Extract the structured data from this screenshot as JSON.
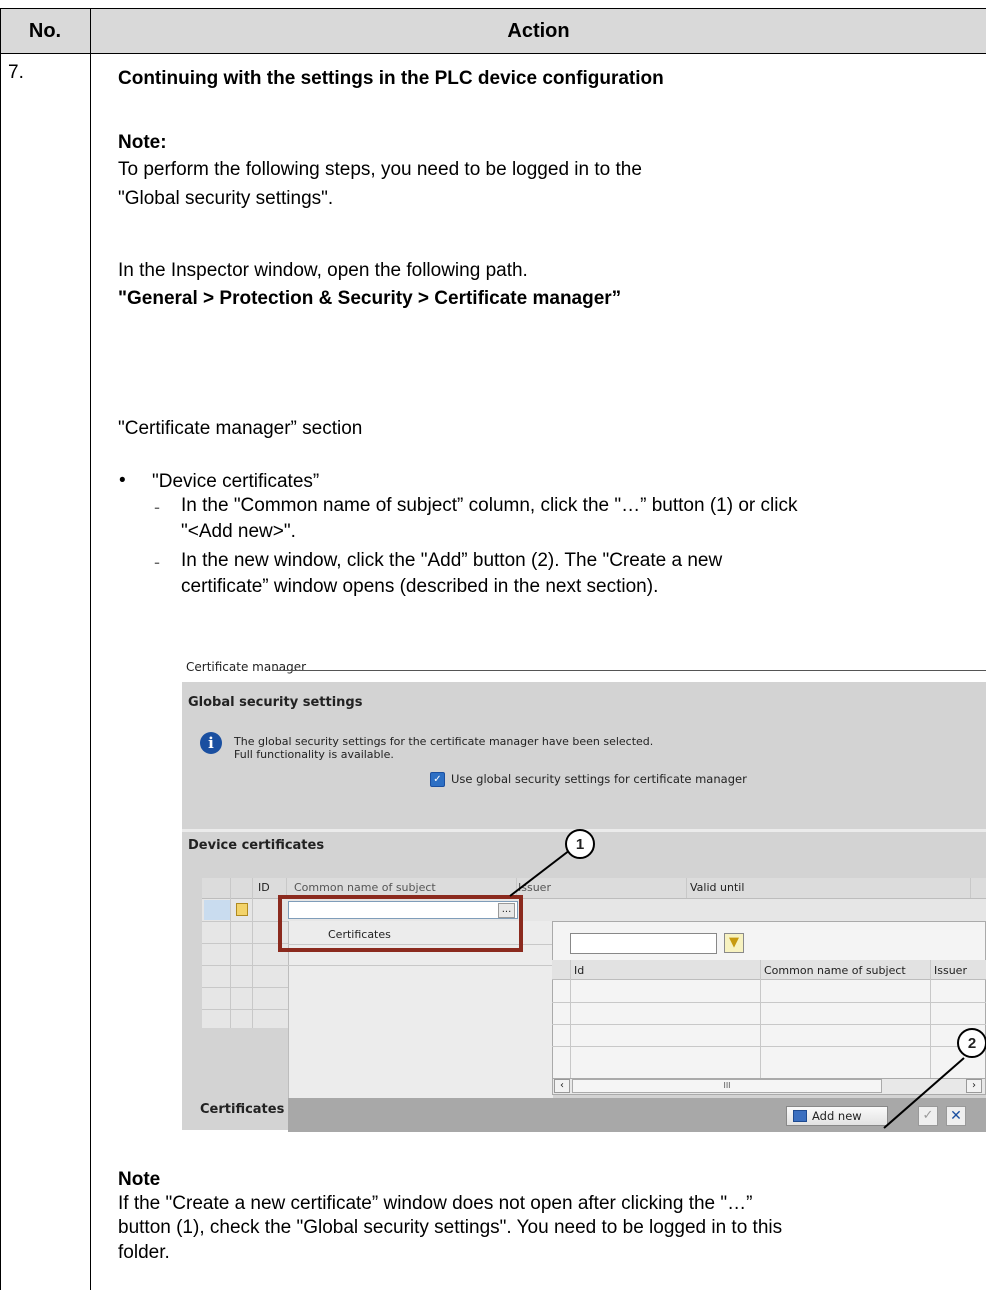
{
  "table": {
    "header_no": "No.",
    "header_action": "Action",
    "step_no": "7."
  },
  "step": {
    "title": "Continuing with the settings in the PLC device configuration",
    "note_label": "Note:",
    "note_line1": "To perform the following steps, you need to be logged in to the",
    "note_line2": "\"Global security settings\".",
    "inspector_text": "In the Inspector window, open the following path.",
    "path": "\"General > Protection & Security > Certificate manager”",
    "section_text": "\"Certificate manager” section",
    "bullet": "•",
    "bullet_label": "\"Device certificates”",
    "dash": "-",
    "sub1_line1": "In the \"Common name of subject” column, click the \"…” button (1) or click",
    "sub1_line2": "\"<Add new>\".",
    "sub2_line1": "In the new window, click the \"Add” button (2). The \"Create a new",
    "sub2_line2": "certificate” window opens (described in the next section).",
    "note2_label": "Note",
    "note2_line1": "If the \"Create a new certificate” window does not open after clicking the \"…”",
    "note2_line2": "button (1), check the \"Global security settings\". You need to be logged in to this",
    "note2_line3": "folder."
  },
  "screenshot": {
    "section_title": "Certificate manager",
    "global_title": "Global security settings",
    "info_line1": "The global security settings for the certificate manager have been selected.",
    "info_line2": "Full functionality is available.",
    "checkbox_label": "Use global security settings for certificate manager",
    "checkbox_checked": true,
    "device_certs_title": "Device certificates",
    "columns": [
      "ID",
      "Common name of subject",
      "Issuer",
      "Valid until"
    ],
    "browse_button": "...",
    "dropdown_item": "Certificates",
    "popup_columns": [
      "Id",
      "Common name of subject",
      "Issuer"
    ],
    "scroll_thumb": "III",
    "certificates_label": "Certificates",
    "add_new_button": "Add new",
    "marker1": "1",
    "marker2": "2",
    "colors": {
      "highlight_border": "#8b2a1e",
      "panel": "#d3d3d3",
      "accent": "#1a4fa0"
    }
  }
}
